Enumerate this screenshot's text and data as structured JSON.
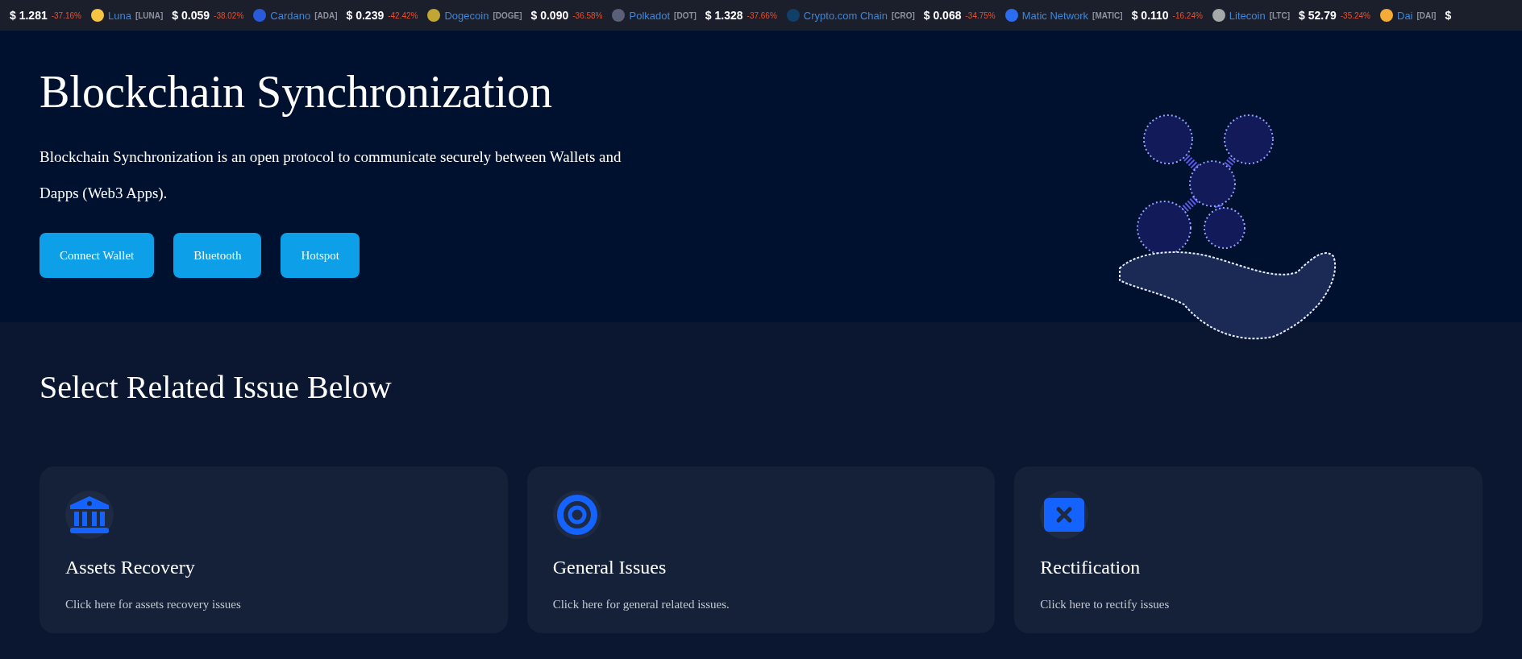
{
  "ticker": [
    {
      "price": "$ 1.281",
      "change": "-37.16%"
    },
    {
      "name": "Luna",
      "symbol": "[LUNA]",
      "price": "$ 0.059",
      "change": "-38.02%",
      "color": "#f5c443"
    },
    {
      "name": "Cardano",
      "symbol": "[ADA]",
      "price": "$ 0.239",
      "change": "-42.42%",
      "color": "#2a5ada"
    },
    {
      "name": "Dogecoin",
      "symbol": "[DOGE]",
      "price": "$ 0.090",
      "change": "-36.58%",
      "color": "#c2a633"
    },
    {
      "name": "Polkadot",
      "symbol": "[DOT]",
      "price": "$ 1.328",
      "change": "-37.66%",
      "color": "#5a6078"
    },
    {
      "name": "Crypto.com Chain",
      "symbol": "[CRO]",
      "price": "$ 0.068",
      "change": "-34.75%",
      "color": "#103f68"
    },
    {
      "name": "Matic Network",
      "symbol": "[MATIC]",
      "price": "$ 0.110",
      "change": "-16.24%",
      "color": "#2b6def"
    },
    {
      "name": "Litecoin",
      "symbol": "[LTC]",
      "price": "$ 52.79",
      "change": "-35.24%",
      "color": "#a6a9aa"
    },
    {
      "name": "Dai",
      "symbol": "[DAI]",
      "price": "$",
      "color": "#f5ac37"
    }
  ],
  "hero": {
    "title": "Blockchain Synchronization",
    "text": "Blockchain Synchronization is an open protocol to communicate securely between Wallets and Dapps (Web3 Apps).",
    "buttons": [
      "Connect Wallet",
      "Bluetooth",
      "Hotspot"
    ]
  },
  "issues": {
    "heading": "Select Related Issue Below",
    "cards": [
      {
        "kind": "bank",
        "title": "Assets Recovery",
        "text": "Click here for assets recovery issues"
      },
      {
        "kind": "target",
        "title": "General Issues",
        "text": "Click here for general related issues."
      },
      {
        "kind": "cross",
        "title": "Rectification",
        "text": "Click here to rectify issues"
      }
    ]
  }
}
